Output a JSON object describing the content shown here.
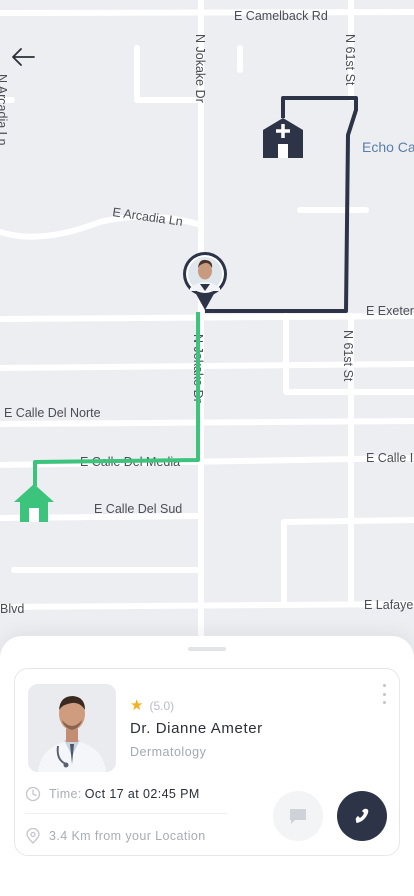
{
  "map": {
    "streets": [
      "E Camelback Rd",
      "N Jokake Dr",
      "N 61st St",
      "Echo Ca",
      "E Arcadia Ln",
      "E Exeter",
      "N Jokake Dr",
      "N 61st St",
      "E Calle Del Norte",
      "E Calle Del Media",
      "E Calle I",
      "E Calle Del Sud",
      "Blvd",
      "E Lafaye",
      "N Arcadia Ln"
    ],
    "route_color": "#3cc47c",
    "destination_color": "#2d3447"
  },
  "doctor": {
    "rating": "(5.0)",
    "name": "Dr. Dianne Ameter",
    "specialty": "Dermatology"
  },
  "appointment": {
    "time_label": "Time:",
    "time_value": "Oct 17 at 02:45 PM",
    "distance": "3.4 Km from your Location"
  },
  "colors": {
    "accent_dark": "#2d3447",
    "star": "#f2b01e"
  }
}
